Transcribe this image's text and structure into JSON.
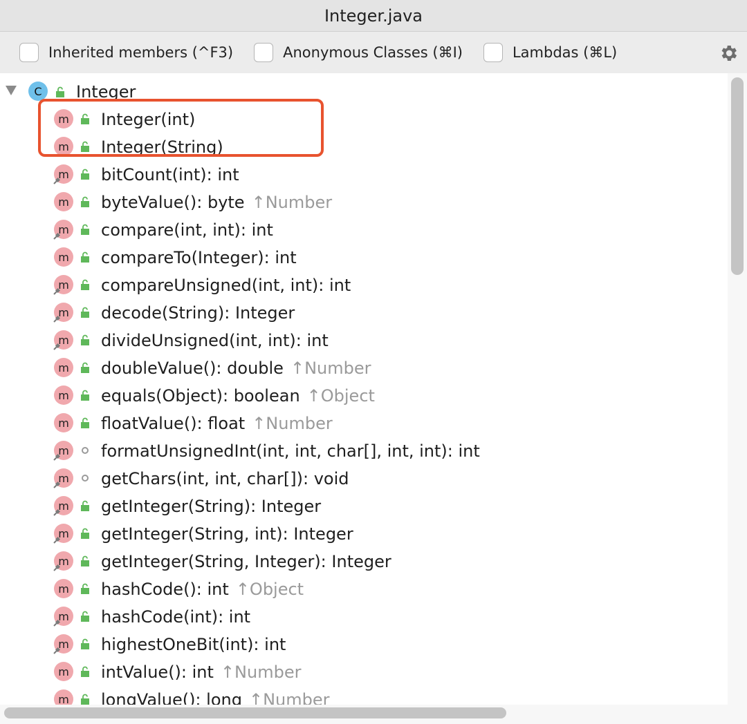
{
  "window": {
    "title": "Integer.java"
  },
  "toolbar": {
    "options": [
      {
        "label": "Inherited members (^F3)",
        "checked": false
      },
      {
        "label": "Anonymous Classes (⌘I)",
        "checked": false
      },
      {
        "label": "Lambdas (⌘L)",
        "checked": false
      }
    ],
    "settings_icon": "gear-icon"
  },
  "tree": {
    "root": {
      "label": "Integer",
      "icon": "C",
      "expanded": true
    },
    "method_icon_letter": "m",
    "members": [
      {
        "sig": "Integer(int)",
        "inherited": "",
        "static": false,
        "access": "public",
        "highlighted": true
      },
      {
        "sig": "Integer(String)",
        "inherited": "",
        "static": false,
        "access": "public",
        "highlighted": true
      },
      {
        "sig": "bitCount(int): int",
        "inherited": "",
        "static": true,
        "access": "public"
      },
      {
        "sig": "byteValue(): byte",
        "inherited": "↑Number",
        "static": false,
        "access": "public"
      },
      {
        "sig": "compare(int, int): int",
        "inherited": "",
        "static": true,
        "access": "public"
      },
      {
        "sig": "compareTo(Integer): int",
        "inherited": "",
        "static": false,
        "access": "public"
      },
      {
        "sig": "compareUnsigned(int, int): int",
        "inherited": "",
        "static": true,
        "access": "public"
      },
      {
        "sig": "decode(String): Integer",
        "inherited": "",
        "static": true,
        "access": "public"
      },
      {
        "sig": "divideUnsigned(int, int): int",
        "inherited": "",
        "static": true,
        "access": "public"
      },
      {
        "sig": "doubleValue(): double",
        "inherited": "↑Number",
        "static": false,
        "access": "public"
      },
      {
        "sig": "equals(Object): boolean",
        "inherited": "↑Object",
        "static": false,
        "access": "public"
      },
      {
        "sig": "floatValue(): float",
        "inherited": "↑Number",
        "static": false,
        "access": "public"
      },
      {
        "sig": "formatUnsignedInt(int, int, char[], int, int): int",
        "inherited": "",
        "static": true,
        "access": "package"
      },
      {
        "sig": "getChars(int, int, char[]): void",
        "inherited": "",
        "static": true,
        "access": "package"
      },
      {
        "sig": "getInteger(String): Integer",
        "inherited": "",
        "static": true,
        "access": "public"
      },
      {
        "sig": "getInteger(String, int): Integer",
        "inherited": "",
        "static": true,
        "access": "public"
      },
      {
        "sig": "getInteger(String, Integer): Integer",
        "inherited": "",
        "static": true,
        "access": "public"
      },
      {
        "sig": "hashCode(): int",
        "inherited": "↑Object",
        "static": false,
        "access": "public"
      },
      {
        "sig": "hashCode(int): int",
        "inherited": "",
        "static": true,
        "access": "public"
      },
      {
        "sig": "highestOneBit(int): int",
        "inherited": "",
        "static": true,
        "access": "public"
      },
      {
        "sig": "intValue(): int",
        "inherited": "↑Number",
        "static": false,
        "access": "public"
      },
      {
        "sig": "longValue(): long",
        "inherited": "↑Number",
        "static": false,
        "access": "public"
      }
    ]
  },
  "colors": {
    "class_icon": "#6fc0ea",
    "method_icon": "#f0a8ad",
    "lock": "#5fb85a",
    "highlight": "#e8532f",
    "inherited_text": "#9a9a9a"
  }
}
